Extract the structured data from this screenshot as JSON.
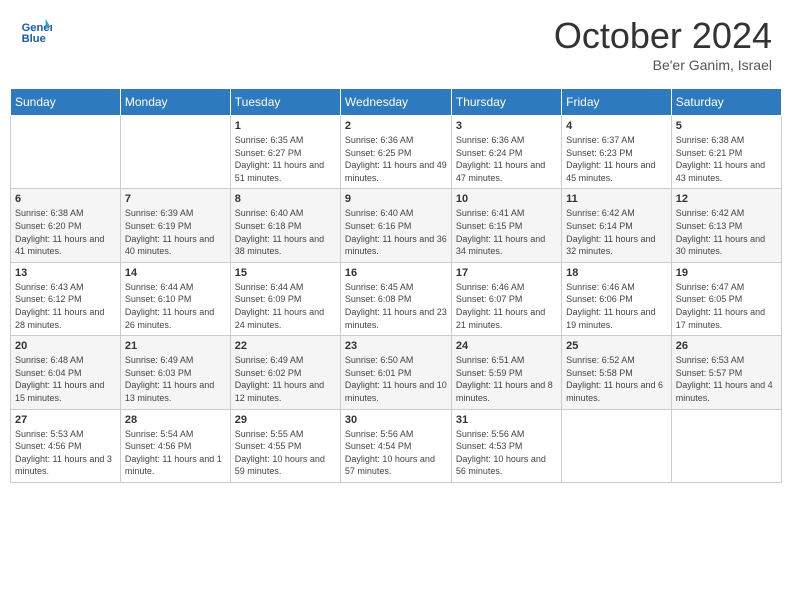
{
  "header": {
    "logo_general": "General",
    "logo_blue": "Blue",
    "month_title": "October 2024",
    "location": "Be'er Ganim, Israel"
  },
  "weekdays": [
    "Sunday",
    "Monday",
    "Tuesday",
    "Wednesday",
    "Thursday",
    "Friday",
    "Saturday"
  ],
  "weeks": [
    [
      {
        "day": "",
        "info": ""
      },
      {
        "day": "",
        "info": ""
      },
      {
        "day": "1",
        "info": "Sunrise: 6:35 AM\nSunset: 6:27 PM\nDaylight: 11 hours and 51 minutes."
      },
      {
        "day": "2",
        "info": "Sunrise: 6:36 AM\nSunset: 6:25 PM\nDaylight: 11 hours and 49 minutes."
      },
      {
        "day": "3",
        "info": "Sunrise: 6:36 AM\nSunset: 6:24 PM\nDaylight: 11 hours and 47 minutes."
      },
      {
        "day": "4",
        "info": "Sunrise: 6:37 AM\nSunset: 6:23 PM\nDaylight: 11 hours and 45 minutes."
      },
      {
        "day": "5",
        "info": "Sunrise: 6:38 AM\nSunset: 6:21 PM\nDaylight: 11 hours and 43 minutes."
      }
    ],
    [
      {
        "day": "6",
        "info": "Sunrise: 6:38 AM\nSunset: 6:20 PM\nDaylight: 11 hours and 41 minutes."
      },
      {
        "day": "7",
        "info": "Sunrise: 6:39 AM\nSunset: 6:19 PM\nDaylight: 11 hours and 40 minutes."
      },
      {
        "day": "8",
        "info": "Sunrise: 6:40 AM\nSunset: 6:18 PM\nDaylight: 11 hours and 38 minutes."
      },
      {
        "day": "9",
        "info": "Sunrise: 6:40 AM\nSunset: 6:16 PM\nDaylight: 11 hours and 36 minutes."
      },
      {
        "day": "10",
        "info": "Sunrise: 6:41 AM\nSunset: 6:15 PM\nDaylight: 11 hours and 34 minutes."
      },
      {
        "day": "11",
        "info": "Sunrise: 6:42 AM\nSunset: 6:14 PM\nDaylight: 11 hours and 32 minutes."
      },
      {
        "day": "12",
        "info": "Sunrise: 6:42 AM\nSunset: 6:13 PM\nDaylight: 11 hours and 30 minutes."
      }
    ],
    [
      {
        "day": "13",
        "info": "Sunrise: 6:43 AM\nSunset: 6:12 PM\nDaylight: 11 hours and 28 minutes."
      },
      {
        "day": "14",
        "info": "Sunrise: 6:44 AM\nSunset: 6:10 PM\nDaylight: 11 hours and 26 minutes."
      },
      {
        "day": "15",
        "info": "Sunrise: 6:44 AM\nSunset: 6:09 PM\nDaylight: 11 hours and 24 minutes."
      },
      {
        "day": "16",
        "info": "Sunrise: 6:45 AM\nSunset: 6:08 PM\nDaylight: 11 hours and 23 minutes."
      },
      {
        "day": "17",
        "info": "Sunrise: 6:46 AM\nSunset: 6:07 PM\nDaylight: 11 hours and 21 minutes."
      },
      {
        "day": "18",
        "info": "Sunrise: 6:46 AM\nSunset: 6:06 PM\nDaylight: 11 hours and 19 minutes."
      },
      {
        "day": "19",
        "info": "Sunrise: 6:47 AM\nSunset: 6:05 PM\nDaylight: 11 hours and 17 minutes."
      }
    ],
    [
      {
        "day": "20",
        "info": "Sunrise: 6:48 AM\nSunset: 6:04 PM\nDaylight: 11 hours and 15 minutes."
      },
      {
        "day": "21",
        "info": "Sunrise: 6:49 AM\nSunset: 6:03 PM\nDaylight: 11 hours and 13 minutes."
      },
      {
        "day": "22",
        "info": "Sunrise: 6:49 AM\nSunset: 6:02 PM\nDaylight: 11 hours and 12 minutes."
      },
      {
        "day": "23",
        "info": "Sunrise: 6:50 AM\nSunset: 6:01 PM\nDaylight: 11 hours and 10 minutes."
      },
      {
        "day": "24",
        "info": "Sunrise: 6:51 AM\nSunset: 5:59 PM\nDaylight: 11 hours and 8 minutes."
      },
      {
        "day": "25",
        "info": "Sunrise: 6:52 AM\nSunset: 5:58 PM\nDaylight: 11 hours and 6 minutes."
      },
      {
        "day": "26",
        "info": "Sunrise: 6:53 AM\nSunset: 5:57 PM\nDaylight: 11 hours and 4 minutes."
      }
    ],
    [
      {
        "day": "27",
        "info": "Sunrise: 5:53 AM\nSunset: 4:56 PM\nDaylight: 11 hours and 3 minutes."
      },
      {
        "day": "28",
        "info": "Sunrise: 5:54 AM\nSunset: 4:56 PM\nDaylight: 11 hours and 1 minute."
      },
      {
        "day": "29",
        "info": "Sunrise: 5:55 AM\nSunset: 4:55 PM\nDaylight: 10 hours and 59 minutes."
      },
      {
        "day": "30",
        "info": "Sunrise: 5:56 AM\nSunset: 4:54 PM\nDaylight: 10 hours and 57 minutes."
      },
      {
        "day": "31",
        "info": "Sunrise: 5:56 AM\nSunset: 4:53 PM\nDaylight: 10 hours and 56 minutes."
      },
      {
        "day": "",
        "info": ""
      },
      {
        "day": "",
        "info": ""
      }
    ]
  ]
}
